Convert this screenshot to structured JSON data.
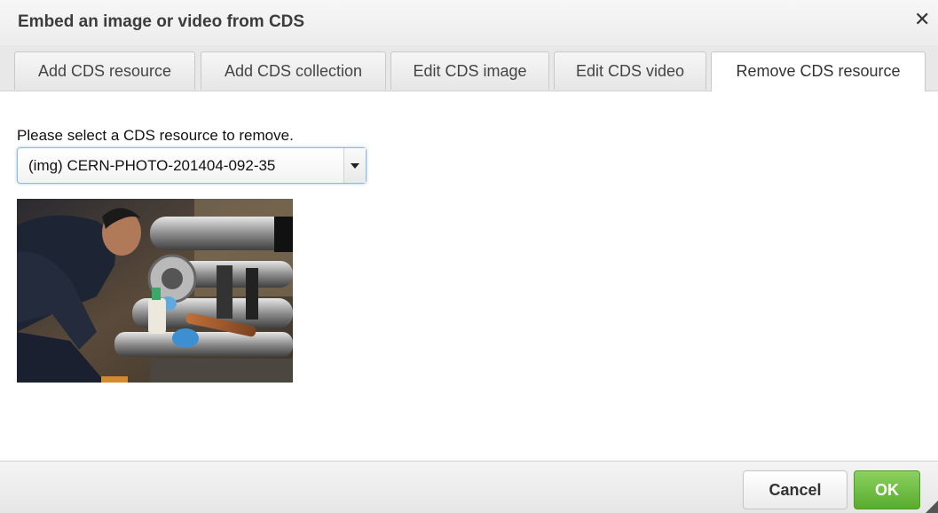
{
  "dialog": {
    "title": "Embed an image or video from CDS",
    "close_glyph": "✕"
  },
  "tabs": [
    {
      "label": "Add CDS resource",
      "active": false
    },
    {
      "label": "Add CDS collection",
      "active": false
    },
    {
      "label": "Edit CDS image",
      "active": false
    },
    {
      "label": "Edit CDS video",
      "active": false
    },
    {
      "label": "Remove CDS resource",
      "active": true
    }
  ],
  "remove_panel": {
    "prompt": "Please select a CDS resource to remove.",
    "selected_resource": "(img) CERN-PHOTO-201404-092-35",
    "preview_icon": "photo-preview"
  },
  "footer": {
    "cancel_label": "Cancel",
    "ok_label": "OK"
  },
  "colors": {
    "ok_green": "#6bbf3f",
    "focus_blue": "#8eb8e6"
  }
}
